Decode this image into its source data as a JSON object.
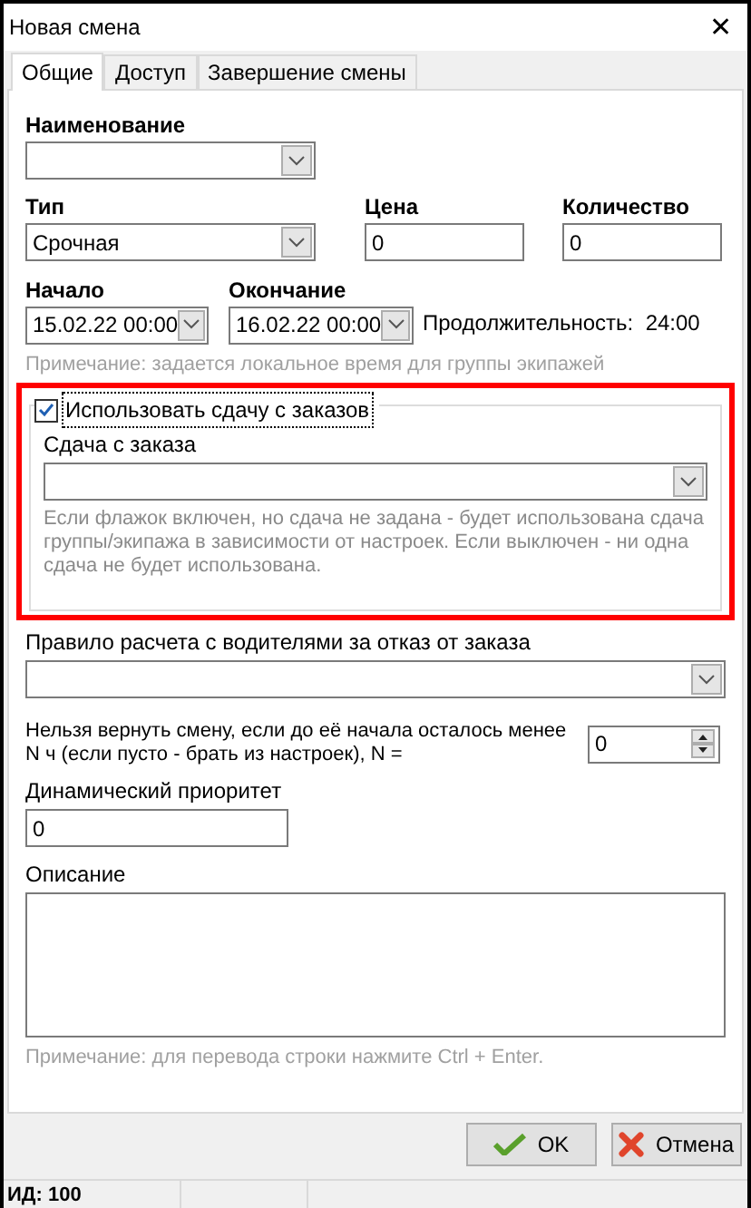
{
  "window": {
    "title": "Новая смена",
    "close": "✕"
  },
  "tabs": [
    {
      "label": "Общие",
      "selected": true
    },
    {
      "label": "Доступ",
      "selected": false
    },
    {
      "label": "Завершение смены",
      "selected": false
    }
  ],
  "name_field": {
    "label": "Наименование"
  },
  "type_field": {
    "label": "Тип",
    "value": "Срочная"
  },
  "price_field": {
    "label": "Цена",
    "value": "0"
  },
  "quantity_field": {
    "label": "Количество",
    "value": "0"
  },
  "start_field": {
    "label": "Начало",
    "value": "15.02.22 00:00"
  },
  "end_field": {
    "label": "Окончание",
    "value": "16.02.22 00:00"
  },
  "duration": {
    "label": "Продолжительность:",
    "value": "24:00"
  },
  "time_note": "Примечание: задается локальное время для группы экипажей",
  "use_change": {
    "label": "Использовать сдачу с заказов",
    "checked": true,
    "change_field": {
      "label": "Сдача с заказа"
    },
    "help": "Если флажок включен, но сдача не задана - будет использована сдача группы/экипажа в зависимости от настроек. Если выключен - ни одна сдача не будет использована."
  },
  "rule_field": {
    "label": "Правило расчета с водителями за отказ от заказа"
  },
  "return_limit": {
    "label": "Нельзя вернуть смену, если до её начала осталось менее N ч (если пусто - брать из настроек), N =",
    "value": "0"
  },
  "priority_field": {
    "label": "Динамический приоритет",
    "value": "0"
  },
  "description_field": {
    "label": "Описание"
  },
  "description_note": "Примечание: для перевода строки нажмите Ctrl + Enter.",
  "buttons": [
    {
      "kind": "ok",
      "label": "OK"
    },
    {
      "kind": "cancel",
      "label": "Отмена"
    }
  ],
  "status_bar": [
    "ИД: 100"
  ]
}
